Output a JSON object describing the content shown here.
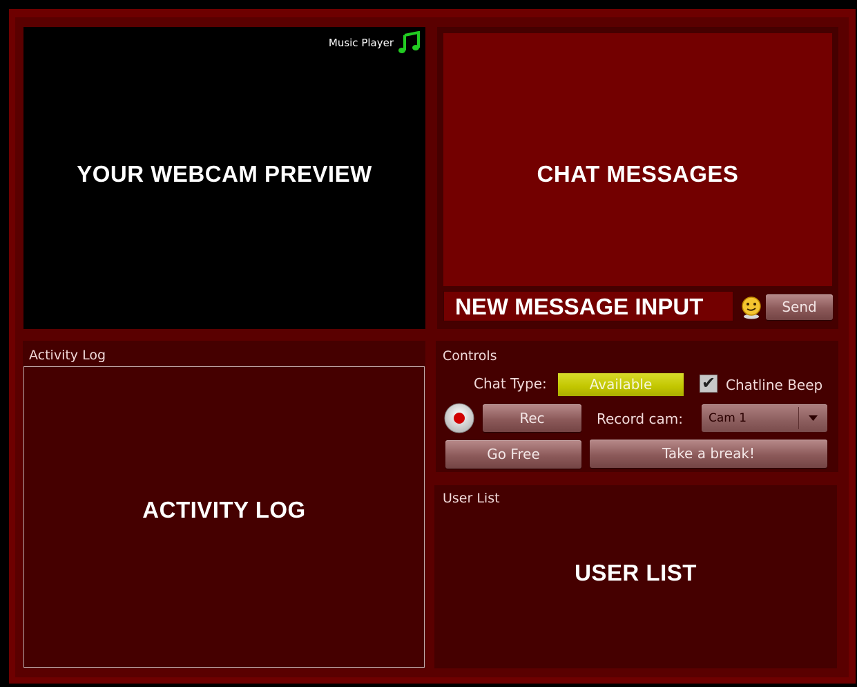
{
  "webcam": {
    "label": "YOUR WEBCAM PREVIEW",
    "music_player_label": "Music Player",
    "music_icon": "music-note-icon",
    "music_icon_color": "#22cc22"
  },
  "chat": {
    "messages_label": "CHAT MESSAGES",
    "input_label": "NEW MESSAGE INPUT",
    "emoticon_icon": "smiley-icon",
    "send_label": "Send"
  },
  "activity_log": {
    "title": "Activity Log",
    "label": "ACTIVITY LOG"
  },
  "controls": {
    "title": "Controls",
    "chat_type_label": "Chat Type:",
    "chat_type_value": "Available",
    "chat_type_color": "#c2c600",
    "chatline_beep_label": "Chatline Beep",
    "chatline_beep_checked": true,
    "record_icon": "record-icon",
    "rec_label": "Rec",
    "record_cam_label": "Record cam:",
    "record_cam_value": "Cam 1",
    "go_free_label": "Go Free",
    "take_break_label": "Take a break!"
  },
  "user_list": {
    "title": "User List",
    "label": "USER LIST"
  },
  "colors": {
    "frame": "#6e0000",
    "panel_dark": "#450000",
    "chat_area": "#730000"
  }
}
